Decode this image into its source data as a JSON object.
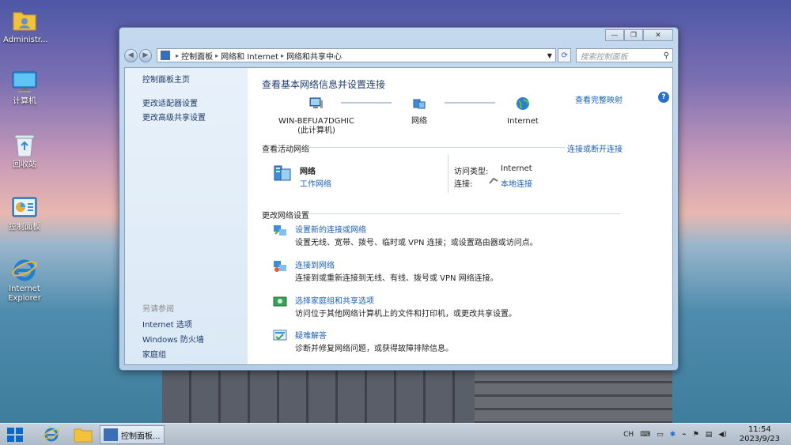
{
  "desktop": {
    "icons": [
      {
        "label": "Administr...",
        "icon": "user-folder-icon"
      },
      {
        "label": "计算机",
        "icon": "computer-icon"
      },
      {
        "label": "回收站",
        "icon": "recycle-bin-icon"
      },
      {
        "label": "控制面板",
        "icon": "control-panel-icon"
      },
      {
        "label": "Internet Explorer",
        "icon": "ie-icon"
      }
    ]
  },
  "window": {
    "controls": {
      "minimize": "—",
      "maximize": "❐",
      "close": "✕"
    },
    "address": {
      "icon": "control-panel-icon",
      "crumbs": [
        "控制面板",
        "网络和 Internet",
        "网络和共享中心"
      ]
    },
    "search_placeholder": "搜索控制面板",
    "left_pane": {
      "home": "控制面板主页",
      "links": [
        "更改适配器设置",
        "更改高级共享设置"
      ],
      "see_also_title": "另请参阅",
      "see_also": [
        "Internet 选项",
        "Windows 防火墙",
        "家庭组"
      ]
    },
    "main": {
      "title": "查看基本网络信息并设置连接",
      "full_map": "查看完整映射",
      "nodes": [
        {
          "label": "WIN-BEFUA7DGHIC",
          "sub": "(此计算机)"
        },
        {
          "label": "网络",
          "sub": ""
        },
        {
          "label": "Internet",
          "sub": ""
        }
      ],
      "active_title": "查看活动网络",
      "connect_toggle": "连接或断开连接",
      "network_name": "网络",
      "network_type": "工作网络",
      "access_type_label": "访问类型:",
      "access_type_value": "Internet",
      "connection_label": "连接:",
      "connection_value": "本地连接",
      "change_title": "更改网络设置",
      "tasks": [
        {
          "title": "设置新的连接或网络",
          "desc": "设置无线、宽带、拨号、临时或 VPN 连接；或设置路由器或访问点。"
        },
        {
          "title": "连接到网络",
          "desc": "连接到或重新连接到无线、有线、拨号或 VPN 网络连接。"
        },
        {
          "title": "选择家庭组和共享选项",
          "desc": "访问位于其他网络计算机上的文件和打印机，或更改共享设置。"
        },
        {
          "title": "疑难解答",
          "desc": "诊断并修复网络问题，或获得故障排除信息。"
        }
      ]
    }
  },
  "taskbar": {
    "app_label": "控制面板...",
    "tray_lang": "CH",
    "time": "11:54",
    "date": "2023/9/23"
  }
}
